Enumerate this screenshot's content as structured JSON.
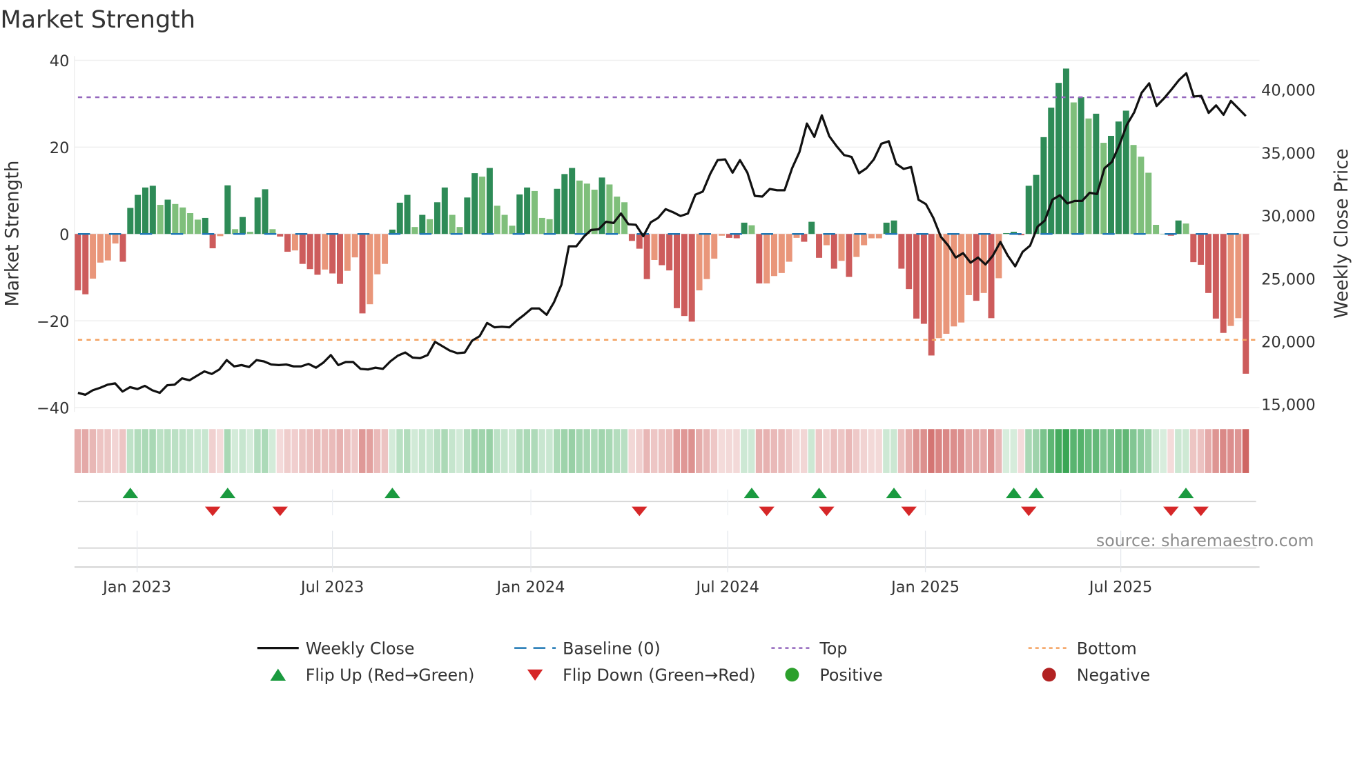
{
  "chart_data": {
    "type": "bar+line",
    "title": "Market Strength",
    "ylabel": "Market Strength",
    "y2label": "Weekly Close Price",
    "ylim": [
      -40,
      40
    ],
    "y2lim": [
      15000,
      42000
    ],
    "yticks": [
      {
        "v": 40,
        "label": "40"
      },
      {
        "v": 20,
        "label": "20"
      },
      {
        "v": 0,
        "label": "0"
      },
      {
        "v": -20,
        "label": "−20"
      },
      {
        "v": -40,
        "label": "−40"
      }
    ],
    "y2ticks": [
      {
        "v": 40000,
        "label": "40,000"
      },
      {
        "v": 35000,
        "label": "35,000"
      },
      {
        "v": 30000,
        "label": "30,000"
      },
      {
        "v": 25000,
        "label": "25,000"
      },
      {
        "v": 20000,
        "label": "20,000"
      },
      {
        "v": 15000,
        "label": "15,000"
      }
    ],
    "xticks": [
      {
        "week": 7.9,
        "label": "Jan 2023"
      },
      {
        "week": 34.0,
        "label": "Jul 2023"
      },
      {
        "week": 60.5,
        "label": "Jan 2024"
      },
      {
        "week": 86.8,
        "label": "Jul 2024"
      },
      {
        "week": 113.2,
        "label": "Jan 2025"
      },
      {
        "week": 139.3,
        "label": "Jul 2025"
      }
    ],
    "grid": true,
    "top_level": 31.5,
    "bottom_level": -24.4,
    "baseline": 0,
    "strength": [
      -13.0,
      -13.9,
      -10.3,
      -6.6,
      -6.1,
      -2.2,
      -6.4,
      6.0,
      9.0,
      10.7,
      11.1,
      6.7,
      7.9,
      6.9,
      6.1,
      4.8,
      3.3,
      3.7,
      -3.3,
      -0.5,
      11.2,
      1.1,
      3.9,
      0.5,
      8.4,
      10.3,
      1.1,
      -0.6,
      -4.1,
      -3.8,
      -6.9,
      -8.1,
      -9.4,
      -8.2,
      -9.1,
      -11.5,
      -8.5,
      -5.4,
      -18.3,
      -16.2,
      -9.3,
      -6.9,
      1.0,
      7.2,
      9.0,
      1.6,
      4.4,
      3.4,
      7.3,
      10.7,
      4.4,
      1.6,
      8.4,
      14.0,
      13.2,
      15.2,
      6.5,
      4.4,
      1.9,
      9.1,
      10.7,
      9.9,
      3.7,
      3.4,
      10.4,
      13.8,
      15.2,
      12.3,
      11.6,
      10.2,
      13.0,
      11.4,
      8.6,
      7.3,
      -1.6,
      -3.4,
      -10.4,
      -6.0,
      -7.2,
      -8.4,
      -17.1,
      -18.9,
      -20.2,
      -13.0,
      -10.4,
      -5.7,
      -0.4,
      -0.9,
      -1.0,
      2.6,
      2.0,
      -11.4,
      -11.4,
      -9.7,
      -9.0,
      -6.4,
      -0.9,
      -1.8,
      2.8,
      -5.5,
      -2.6,
      -8.0,
      -6.2,
      -9.9,
      -5.3,
      -2.6,
      -1.0,
      -1.0,
      2.6,
      3.1,
      -8.0,
      -12.7,
      -19.5,
      -20.7,
      -28.0,
      -24.0,
      -23.0,
      -21.3,
      -20.4,
      -14.1,
      -15.4,
      -13.6,
      -19.4,
      -10.2,
      0.2,
      0.5,
      -0.3,
      11.1,
      13.6,
      22.3,
      29.1,
      34.8,
      38.1,
      30.3,
      31.5,
      26.6,
      27.7,
      21.0,
      22.6,
      25.9,
      28.4,
      20.5,
      17.8,
      14.1,
      2.1,
      0.0,
      -0.4,
      3.1,
      2.4,
      -6.5,
      -7.1,
      -13.6,
      -19.5,
      -22.8,
      -21.2,
      -19.4,
      -32.2
    ],
    "weekly_close": [
      15900,
      15750,
      16100,
      16300,
      16550,
      16650,
      16000,
      16350,
      16200,
      16450,
      16100,
      15900,
      16500,
      16550,
      17050,
      16900,
      17250,
      17600,
      17400,
      17750,
      18500,
      18000,
      18100,
      17950,
      18500,
      18400,
      18150,
      18100,
      18150,
      18000,
      18000,
      18200,
      17900,
      18300,
      18900,
      18100,
      18350,
      18350,
      17800,
      17750,
      17900,
      17800,
      18400,
      18850,
      19100,
      18700,
      18650,
      18900,
      19950,
      19600,
      19250,
      19050,
      19100,
      20050,
      20400,
      21450,
      21100,
      21150,
      21100,
      21650,
      22100,
      22600,
      22600,
      22100,
      23100,
      24500,
      27550,
      27550,
      28300,
      28850,
      28900,
      29500,
      29400,
      30150,
      29300,
      29250,
      28350,
      29450,
      29800,
      30500,
      30250,
      29950,
      30150,
      31650,
      31900,
      33300,
      34400,
      34450,
      33400,
      34400,
      33400,
      31550,
      31500,
      32100,
      32000,
      32000,
      33750,
      35050,
      37300,
      36250,
      37950,
      36300,
      35500,
      34800,
      34650,
      33350,
      33750,
      34450,
      35700,
      35900,
      34100,
      33700,
      33850,
      31250,
      30900,
      29800,
      28300,
      27600,
      26650,
      27000,
      26250,
      26650,
      26100,
      26800,
      27900,
      26800,
      25950,
      27100,
      27600,
      29100,
      29600,
      31250,
      31600,
      30950,
      31150,
      31150,
      31800,
      31700,
      33750,
      34250,
      35600,
      37200,
      38200,
      39750,
      40500,
      38700,
      39300,
      40000,
      40750,
      41300,
      39450,
      39500,
      38150,
      38750,
      38000,
      39100,
      38500,
      37900
    ],
    "flip_up_weeks": [
      7,
      20,
      42,
      90,
      99,
      109,
      125,
      128,
      148
    ],
    "flip_down_weeks": [
      18,
      27,
      75,
      92,
      100,
      111,
      127,
      146,
      150
    ],
    "colors": {
      "pos_strong": "#2e8b57",
      "pos_weak": "#7fbf7b",
      "neg_strong": "#cd5c5c",
      "neg_weak": "#e9967a",
      "close": "#111111",
      "baseline": "#1f77b4",
      "top": "#9467bd",
      "bottom": "#f4a261",
      "flip_up": "#1a9a3f",
      "flip_down": "#d62728",
      "positive": "#2ca02c",
      "negative": "#b22222"
    },
    "legend": {
      "placement": "bottom",
      "items": [
        {
          "key": "close",
          "label": "Weekly Close"
        },
        {
          "key": "baseline",
          "label": "Baseline (0)"
        },
        {
          "key": "top",
          "label": "Top"
        },
        {
          "key": "bottom",
          "label": "Bottom"
        },
        {
          "key": "flip_up",
          "label": "Flip Up (Red→Green)"
        },
        {
          "key": "flip_down",
          "label": "Flip Down (Green→Red)"
        },
        {
          "key": "positive",
          "label": "Positive"
        },
        {
          "key": "negative",
          "label": "Negative"
        }
      ]
    },
    "source": "source: sharemaestro.com"
  }
}
